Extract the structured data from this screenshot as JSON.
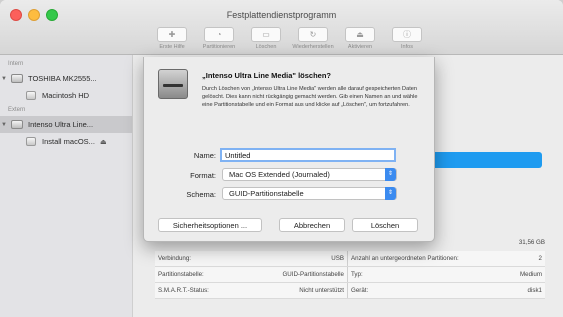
{
  "window": {
    "title": "Festplattendienstprogramm"
  },
  "toolbar": {
    "items": [
      {
        "label": "Erste Hilfe",
        "icon": "first-aid-icon",
        "glyph": "✚"
      },
      {
        "label": "Partitionieren",
        "icon": "partition-icon",
        "glyph": "◔"
      },
      {
        "label": "Löschen",
        "icon": "erase-icon",
        "glyph": "▭"
      },
      {
        "label": "Wiederherstellen",
        "icon": "restore-icon",
        "glyph": "↻"
      },
      {
        "label": "Aktivieren",
        "icon": "mount-icon",
        "glyph": "⏏"
      },
      {
        "label": "Infos",
        "icon": "info-icon",
        "glyph": "ⓘ"
      }
    ]
  },
  "sidebar": {
    "internal_label": "Intern",
    "external_label": "Extern",
    "internal": [
      {
        "label": "TOSHIBA MK2555...",
        "kind": "disk"
      },
      {
        "label": "Macintosh HD",
        "kind": "volume"
      }
    ],
    "external": [
      {
        "label": "Intenso Ultra Line...",
        "kind": "disk",
        "selected": true
      },
      {
        "label": "Install macOS...",
        "kind": "volume"
      }
    ]
  },
  "dialog": {
    "title": "„Intenso Ultra Line Media\" löschen?",
    "body": "Durch Löschen von „Intenso Ultra Line Media\" werden alle darauf gespeicherten Daten gelöscht. Dies kann nicht rückgängig gemacht werden. Gib einen Namen an und wähle eine Partitionstabelle und ein Format aus und klicke auf „Löschen\", um fortzufahren.",
    "name_label": "Name:",
    "name_value": "Untitled",
    "format_label": "Format:",
    "format_value": "Mac OS Extended (Journaled)",
    "scheme_label": "Schema:",
    "scheme_value": "GUID-Partitionstabelle",
    "security_button": "Sicherheitsoptionen ...",
    "cancel_button": "Abbrechen",
    "erase_button": "Löschen"
  },
  "info": {
    "size": "31,56 GB",
    "rows": [
      {
        "l1": "Verbindung:",
        "v1": "USB",
        "l2": "Anzahl an untergeordneten Partitionen:",
        "v2": "2"
      },
      {
        "l1": "Partitionstabelle:",
        "v1": "GUID-Partitionstabelle",
        "l2": "Typ:",
        "v2": "Medium"
      },
      {
        "l1": "S.M.A.R.T.-Status:",
        "v1": "Nicht unterstützt",
        "l2": "Gerät:",
        "v2": "disk1"
      }
    ]
  }
}
